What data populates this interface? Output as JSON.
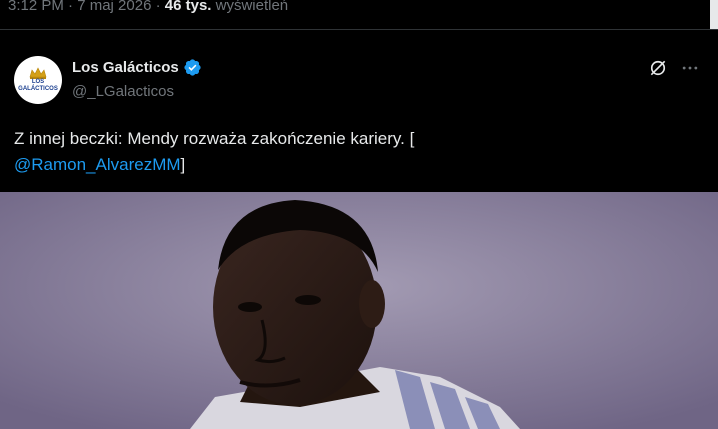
{
  "meta": {
    "time_date": "3:12 PM · 7 maj 2026 · ",
    "views_count": "46 tys.",
    "views_label": " wyświetleń"
  },
  "tweet": {
    "avatar_text": "LOS GALÁCTICOS",
    "display_name": "Los Galácticos",
    "handle": "@_LGalacticos",
    "text_line1": "Z innej beczki: Mendy rozważa zakończenie kariery. [",
    "mention": "@Ramon_AlvarezMM",
    "text_end": "]"
  },
  "icons": {
    "verified": "verified-badge-icon",
    "grok": "grok-icon",
    "more": "more-icon"
  },
  "colors": {
    "background": "#000000",
    "text": "#e7e9ea",
    "secondary": "#71767b",
    "link": "#1d9bf0",
    "verified": "#1d9bf0"
  }
}
